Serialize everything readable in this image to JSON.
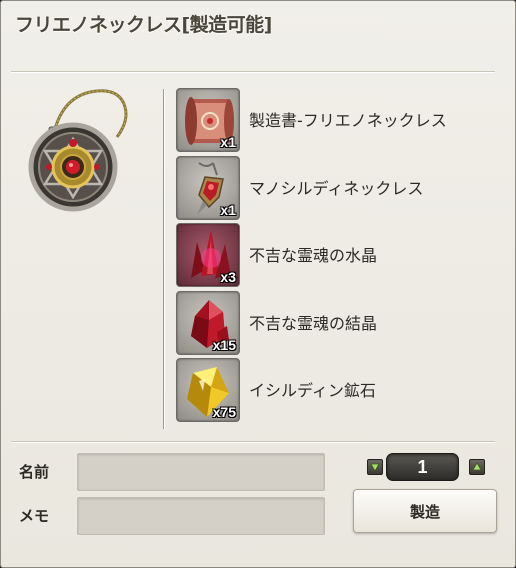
{
  "window": {
    "title": "フリエノネックレス[製造可能]"
  },
  "product": {
    "icon": "pendant-necklace-icon"
  },
  "materials": [
    {
      "name": "製造書-フリエノネックレス",
      "qty": "x1",
      "icon": "recipe-scroll-icon"
    },
    {
      "name": "マノシルディネックレス",
      "qty": "x1",
      "icon": "pendant-icon"
    },
    {
      "name": "不吉な霊魂の水晶",
      "qty": "x3",
      "icon": "red-crystal-cluster-icon"
    },
    {
      "name": "不吉な霊魂の結晶",
      "qty": "x15",
      "icon": "red-gem-icon"
    },
    {
      "name": "イシルディン鉱石",
      "qty": "x75",
      "icon": "gold-ore-icon"
    }
  ],
  "form": {
    "name_label": "名前",
    "memo_label": "メモ",
    "name_value": "",
    "memo_value": ""
  },
  "quantity": {
    "value": "1"
  },
  "actions": {
    "craft_label": "製造"
  },
  "colors": {
    "panel": "#eeebe4",
    "text": "#2d2a25",
    "accent_red": "#b0162a",
    "gold": "#e8c22a"
  }
}
